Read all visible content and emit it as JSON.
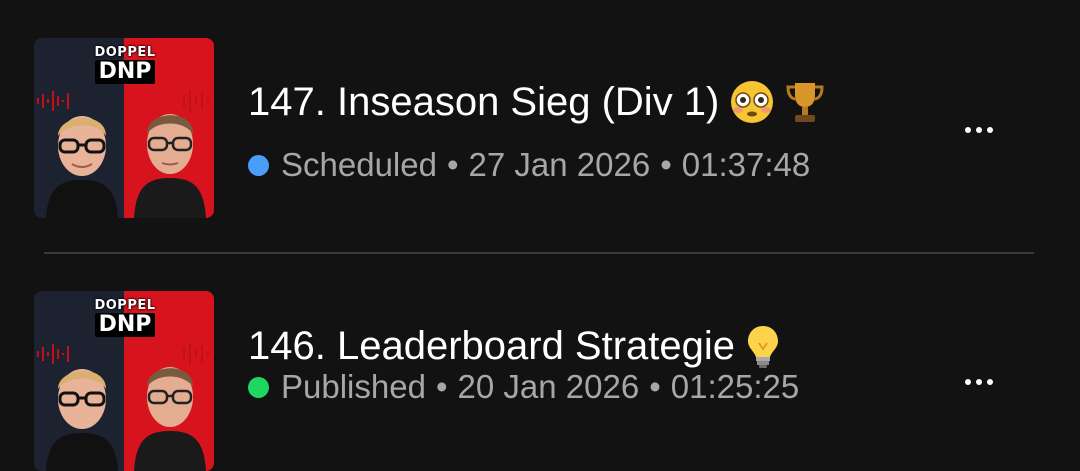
{
  "episodes": [
    {
      "cover_text_top": "DOPPEL",
      "cover_text_bottom": "DNP",
      "title": "147. Inseason Sieg (Div 1)",
      "title_emojis": [
        "flushed-face",
        "trophy"
      ],
      "status": "Scheduled",
      "status_color": "#4a9df8",
      "date": "27 Jan 2026",
      "duration": "01:37:48"
    },
    {
      "cover_text_top": "DOPPEL",
      "cover_text_bottom": "DNP",
      "title": "146. Leaderboard Strategie",
      "title_emojis": [
        "light-bulb"
      ],
      "status": "Published",
      "status_color": "#1ed760",
      "date": "20 Jan 2026",
      "duration": "01:25:25"
    }
  ],
  "separator": "•"
}
